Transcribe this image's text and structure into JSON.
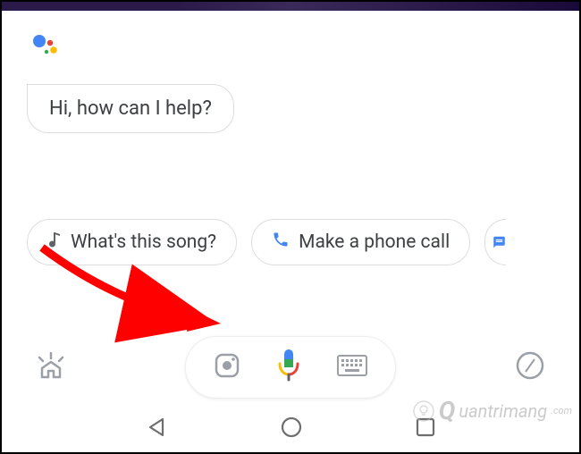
{
  "greeting": "Hi, how can I help?",
  "suggestions": [
    {
      "label": "What's this song?"
    },
    {
      "label": "Make a phone call"
    }
  ],
  "watermark": {
    "text": "uantrimang",
    "suffix": ".com"
  },
  "colors": {
    "google_blue": "#4285F4",
    "google_red": "#EA4335",
    "google_yellow": "#FBBC05",
    "google_green": "#34A853",
    "gray": "#9AA0A6",
    "text": "#3c4043"
  }
}
